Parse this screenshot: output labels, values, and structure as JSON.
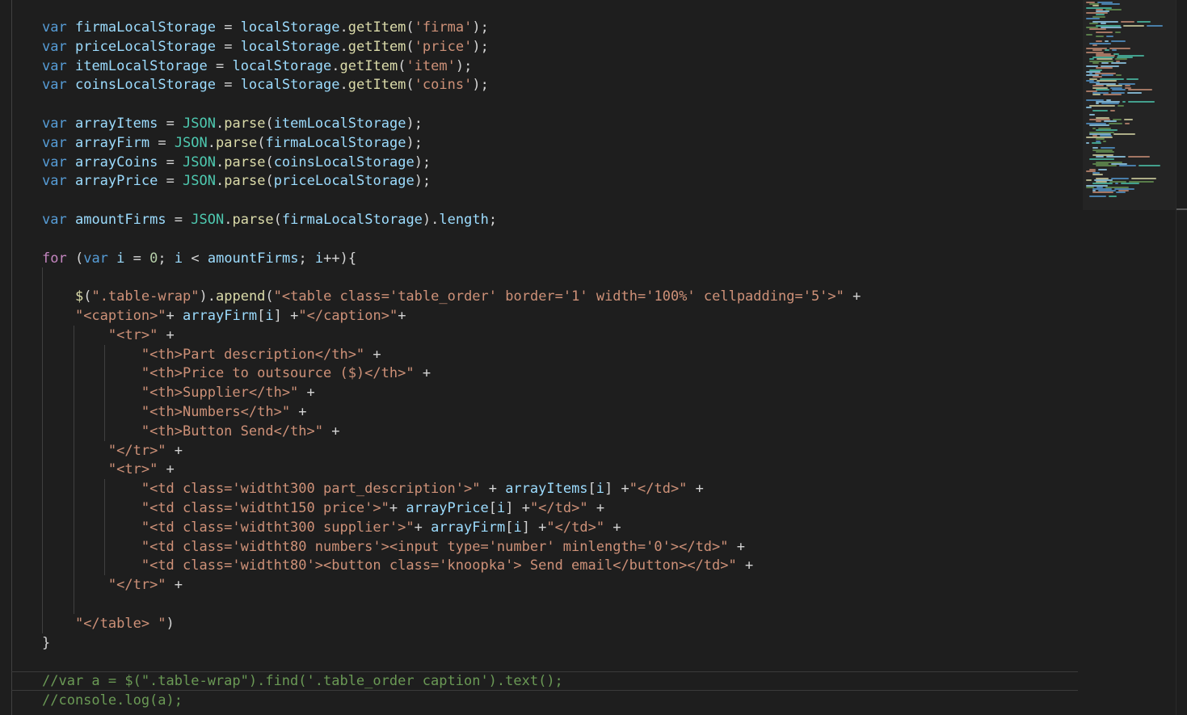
{
  "editor": {
    "lines": [
      [
        [
          "kw",
          "var"
        ],
        [
          "op",
          " "
        ],
        [
          "v",
          "firmaLocalStorage"
        ],
        [
          "op",
          " = "
        ],
        [
          "v",
          "localStorage"
        ],
        [
          "op",
          "."
        ],
        [
          "fn",
          "getItem"
        ],
        [
          "op",
          "("
        ],
        [
          "str",
          "'firma'"
        ],
        [
          "op",
          ");"
        ]
      ],
      [
        [
          "kw",
          "var"
        ],
        [
          "op",
          " "
        ],
        [
          "v",
          "priceLocalStorage"
        ],
        [
          "op",
          " = "
        ],
        [
          "v",
          "localStorage"
        ],
        [
          "op",
          "."
        ],
        [
          "fn",
          "getItem"
        ],
        [
          "op",
          "("
        ],
        [
          "str",
          "'price'"
        ],
        [
          "op",
          ");"
        ]
      ],
      [
        [
          "kw",
          "var"
        ],
        [
          "op",
          " "
        ],
        [
          "v",
          "itemLocalStorage"
        ],
        [
          "op",
          " = "
        ],
        [
          "v",
          "localStorage"
        ],
        [
          "op",
          "."
        ],
        [
          "fn",
          "getItem"
        ],
        [
          "op",
          "("
        ],
        [
          "str",
          "'item'"
        ],
        [
          "op",
          ");"
        ]
      ],
      [
        [
          "kw",
          "var"
        ],
        [
          "op",
          " "
        ],
        [
          "v",
          "coinsLocalStorage"
        ],
        [
          "op",
          " = "
        ],
        [
          "v",
          "localStorage"
        ],
        [
          "op",
          "."
        ],
        [
          "fn",
          "getItem"
        ],
        [
          "op",
          "("
        ],
        [
          "str",
          "'coins'"
        ],
        [
          "op",
          ");"
        ]
      ],
      [],
      [
        [
          "kw",
          "var"
        ],
        [
          "op",
          " "
        ],
        [
          "v",
          "arrayItems"
        ],
        [
          "op",
          " = "
        ],
        [
          "cls",
          "JSON"
        ],
        [
          "op",
          "."
        ],
        [
          "fn",
          "parse"
        ],
        [
          "op",
          "("
        ],
        [
          "v",
          "itemLocalStorage"
        ],
        [
          "op",
          ");"
        ]
      ],
      [
        [
          "kw",
          "var"
        ],
        [
          "op",
          " "
        ],
        [
          "v",
          "arrayFirm"
        ],
        [
          "op",
          " = "
        ],
        [
          "cls",
          "JSON"
        ],
        [
          "op",
          "."
        ],
        [
          "fn",
          "parse"
        ],
        [
          "op",
          "("
        ],
        [
          "v",
          "firmaLocalStorage"
        ],
        [
          "op",
          ");"
        ]
      ],
      [
        [
          "kw",
          "var"
        ],
        [
          "op",
          " "
        ],
        [
          "v",
          "arrayCoins"
        ],
        [
          "op",
          " = "
        ],
        [
          "cls",
          "JSON"
        ],
        [
          "op",
          "."
        ],
        [
          "fn",
          "parse"
        ],
        [
          "op",
          "("
        ],
        [
          "v",
          "coinsLocalStorage"
        ],
        [
          "op",
          ");"
        ]
      ],
      [
        [
          "kw",
          "var"
        ],
        [
          "op",
          " "
        ],
        [
          "v",
          "arrayPrice"
        ],
        [
          "op",
          " = "
        ],
        [
          "cls",
          "JSON"
        ],
        [
          "op",
          "."
        ],
        [
          "fn",
          "parse"
        ],
        [
          "op",
          "("
        ],
        [
          "v",
          "priceLocalStorage"
        ],
        [
          "op",
          ");"
        ]
      ],
      [],
      [
        [
          "kw",
          "var"
        ],
        [
          "op",
          " "
        ],
        [
          "v",
          "amountFirms"
        ],
        [
          "op",
          " = "
        ],
        [
          "cls",
          "JSON"
        ],
        [
          "op",
          "."
        ],
        [
          "fn",
          "parse"
        ],
        [
          "op",
          "("
        ],
        [
          "v",
          "firmaLocalStorage"
        ],
        [
          "op",
          ")."
        ],
        [
          "v",
          "length"
        ],
        [
          "op",
          ";"
        ]
      ],
      [],
      [
        [
          "ctl",
          "for"
        ],
        [
          "op",
          " ("
        ],
        [
          "kw",
          "var"
        ],
        [
          "op",
          " "
        ],
        [
          "v",
          "i"
        ],
        [
          "op",
          " = "
        ],
        [
          "num",
          "0"
        ],
        [
          "op",
          "; "
        ],
        [
          "v",
          "i"
        ],
        [
          "op",
          " < "
        ],
        [
          "v",
          "amountFirms"
        ],
        [
          "op",
          "; "
        ],
        [
          "v",
          "i"
        ],
        [
          "op",
          "++){"
        ]
      ],
      [],
      [
        [
          "op",
          "    "
        ],
        [
          "fn",
          "$"
        ],
        [
          "op",
          "("
        ],
        [
          "str",
          "\".table-wrap\""
        ],
        [
          "op",
          ")."
        ],
        [
          "fn",
          "append"
        ],
        [
          "op",
          "("
        ],
        [
          "str",
          "\"<table class='table_order' border='1' width='100%' cellpadding='5'>\""
        ],
        [
          "op",
          " +"
        ]
      ],
      [
        [
          "op",
          "    "
        ],
        [
          "str",
          "\"<caption>\""
        ],
        [
          "op",
          "+ "
        ],
        [
          "v",
          "arrayFirm"
        ],
        [
          "op",
          "["
        ],
        [
          "v",
          "i"
        ],
        [
          "op",
          "] +"
        ],
        [
          "str",
          "\"</caption>\""
        ],
        [
          "op",
          "+"
        ]
      ],
      [
        [
          "op",
          "        "
        ],
        [
          "str",
          "\"<tr>\""
        ],
        [
          "op",
          " +"
        ]
      ],
      [
        [
          "op",
          "            "
        ],
        [
          "str",
          "\"<th>Part description</th>\""
        ],
        [
          "op",
          " +"
        ]
      ],
      [
        [
          "op",
          "            "
        ],
        [
          "str",
          "\"<th>Price to outsource ($)</th>\""
        ],
        [
          "op",
          " +"
        ]
      ],
      [
        [
          "op",
          "            "
        ],
        [
          "str",
          "\"<th>Supplier</th>\""
        ],
        [
          "op",
          " +"
        ]
      ],
      [
        [
          "op",
          "            "
        ],
        [
          "str",
          "\"<th>Numbers</th>\""
        ],
        [
          "op",
          " +"
        ]
      ],
      [
        [
          "op",
          "            "
        ],
        [
          "str",
          "\"<th>Button Send</th>\""
        ],
        [
          "op",
          " +"
        ]
      ],
      [
        [
          "op",
          "        "
        ],
        [
          "str",
          "\"</tr>\""
        ],
        [
          "op",
          " +"
        ]
      ],
      [
        [
          "op",
          "        "
        ],
        [
          "str",
          "\"<tr>\""
        ],
        [
          "op",
          " +"
        ]
      ],
      [
        [
          "op",
          "            "
        ],
        [
          "str",
          "\"<td class='widtht300 part_description'>\""
        ],
        [
          "op",
          " + "
        ],
        [
          "v",
          "arrayItems"
        ],
        [
          "op",
          "["
        ],
        [
          "v",
          "i"
        ],
        [
          "op",
          "] +"
        ],
        [
          "str",
          "\"</td>\""
        ],
        [
          "op",
          " +"
        ]
      ],
      [
        [
          "op",
          "            "
        ],
        [
          "str",
          "\"<td class='widtht150 price'>\""
        ],
        [
          "op",
          "+ "
        ],
        [
          "v",
          "arrayPrice"
        ],
        [
          "op",
          "["
        ],
        [
          "v",
          "i"
        ],
        [
          "op",
          "] +"
        ],
        [
          "str",
          "\"</td>\""
        ],
        [
          "op",
          " +"
        ]
      ],
      [
        [
          "op",
          "            "
        ],
        [
          "str",
          "\"<td class='widtht300 supplier'>\""
        ],
        [
          "op",
          "+ "
        ],
        [
          "v",
          "arrayFirm"
        ],
        [
          "op",
          "["
        ],
        [
          "v",
          "i"
        ],
        [
          "op",
          "] +"
        ],
        [
          "str",
          "\"</td>\""
        ],
        [
          "op",
          " +"
        ]
      ],
      [
        [
          "op",
          "            "
        ],
        [
          "str",
          "\"<td class='widtht80 numbers'><input type='number' minlength='0'></td>\""
        ],
        [
          "op",
          " +"
        ]
      ],
      [
        [
          "op",
          "            "
        ],
        [
          "str",
          "\"<td class='widtht80'><button class='knoopka'> Send email</button></td>\""
        ],
        [
          "op",
          " +"
        ]
      ],
      [
        [
          "op",
          "        "
        ],
        [
          "str",
          "\"</tr>\""
        ],
        [
          "op",
          " +"
        ]
      ],
      [],
      [
        [
          "op",
          "    "
        ],
        [
          "str",
          "\"</table> \""
        ],
        [
          "op",
          ")"
        ]
      ],
      [
        [
          "op",
          "}"
        ]
      ],
      [],
      [
        [
          "cm",
          "//var a = $(\".table-wrap\").find('.table_order caption').text();"
        ]
      ],
      [
        [
          "cm",
          "//console.log(a);"
        ]
      ]
    ]
  },
  "colors": {
    "keyword": "#569cd6",
    "control": "#c586c0",
    "variable": "#9cdcfe",
    "function": "#dcdcaa",
    "class": "#4ec9b0",
    "string": "#ce9178",
    "number": "#b5cea8",
    "comment": "#6a9955",
    "background": "#1e1e1e"
  }
}
